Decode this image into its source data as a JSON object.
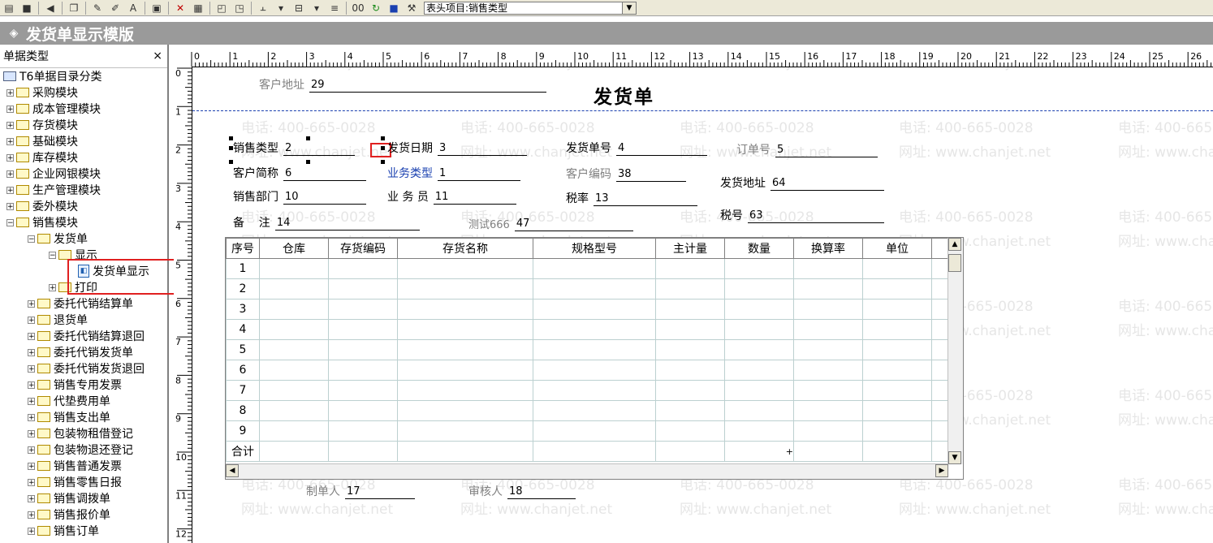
{
  "toolbar": {
    "combo_value": "表头项目:销售类型",
    "icons": [
      "page-icon",
      "save-icon",
      "undo-icon",
      "copy-icon",
      "edit-icon",
      "draw-icon",
      "text-icon",
      "properties-icon",
      "delete-icon",
      "insert-icon",
      "layer-icon",
      "layer2-icon",
      "align-icon",
      "size-icon",
      "list-icon",
      "glasses-icon",
      "refresh-icon",
      "lock-icon",
      "tool-icon"
    ],
    "text_a": "A",
    "text_oo": "00"
  },
  "window": {
    "title": "发货单显示模版"
  },
  "left_panel": {
    "header": "单据类型",
    "close": "×",
    "tree": {
      "root": "T6单据目录分类",
      "modules": [
        "采购模块",
        "成本管理模块",
        "存货模块",
        "基础模块",
        "库存模块",
        "企业网银模块",
        "生产管理模块",
        "委外模块",
        "销售模块"
      ],
      "sales_children": {
        "fahuo": "发货单",
        "display": "显示",
        "display_item": "发货单显示",
        "print": "打印"
      },
      "sales_rest": [
        "委托代销结算单",
        "退货单",
        "委托代销结算退回",
        "委托代销发货单",
        "委托代销发货退回",
        "销售专用发票",
        "代垫费用单",
        "销售支出单",
        "包装物租借登记",
        "包装物退还登记",
        "销售普通发票",
        "销售零售日报",
        "销售调拨单",
        "销售报价单",
        "销售订单"
      ]
    }
  },
  "ruler": {
    "top_numbers": [
      "0",
      "1",
      "2",
      "3",
      "4",
      "5",
      "6",
      "7",
      "8",
      "9",
      "10",
      "11",
      "12",
      "13",
      "14",
      "15",
      "16",
      "17",
      "18",
      "19",
      "20",
      "21",
      "22",
      "23",
      "24",
      "25",
      "26"
    ],
    "left_numbers": [
      "0",
      "1",
      "2",
      "3",
      "4",
      "5",
      "6",
      "7",
      "8",
      "9",
      "10",
      "11",
      "12"
    ]
  },
  "form": {
    "doc_title": "发货单",
    "customer_address": {
      "label": "客户地址",
      "value": "29"
    },
    "sale_type": {
      "label": "销售类型",
      "value": "2"
    },
    "ship_date": {
      "label": "发货日期",
      "value": "3"
    },
    "ship_no": {
      "label": "发货单号",
      "value": "4"
    },
    "order_no": {
      "label": "订单号",
      "value": "5"
    },
    "customer_short": {
      "label": "客户简称",
      "value": "6"
    },
    "biz_type": {
      "label": "业务类型",
      "value": "1"
    },
    "customer_code": {
      "label": "客户编码",
      "value": "38"
    },
    "ship_addr": {
      "label": "发货地址",
      "value": "64"
    },
    "sales_dept": {
      "label": "销售部门",
      "value": "10"
    },
    "salesman": {
      "label": "业 务 员",
      "value": "11"
    },
    "tax_rate": {
      "label": "税率",
      "value": "13"
    },
    "tax_no": {
      "label": "税号",
      "value": "63"
    },
    "remark": {
      "label": "备    注",
      "value": "14"
    },
    "test": {
      "label": "测试666",
      "value": "47"
    },
    "maker": {
      "label": "制单人",
      "value": "17"
    },
    "auditor": {
      "label": "审核人",
      "value": "18"
    }
  },
  "grid": {
    "headers": [
      "序号",
      "仓库",
      "存货编码",
      "存货名称",
      "规格型号",
      "主计量",
      "数量",
      "换算率",
      "单位"
    ],
    "rows": [
      "1",
      "2",
      "3",
      "4",
      "5",
      "6",
      "7",
      "8",
      "9"
    ],
    "total_label": "合计",
    "total_mark": "+"
  },
  "watermark": {
    "phone": "电话: 400-665-0028",
    "site": "网址: www.chanjet.net"
  }
}
